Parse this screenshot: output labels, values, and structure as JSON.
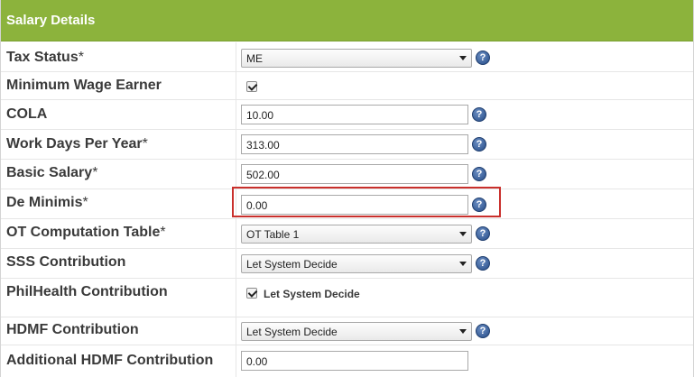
{
  "panel": {
    "title": "Salary Details"
  },
  "fields": {
    "tax_status": {
      "label": "Tax Status",
      "req": "*",
      "value": "ME"
    },
    "min_wage": {
      "label": "Minimum Wage Earner",
      "checked": true
    },
    "cola": {
      "label": "COLA",
      "value": "10.00"
    },
    "work_days": {
      "label": "Work Days Per Year",
      "req": "*",
      "value": "313.00"
    },
    "basic_salary": {
      "label": "Basic Salary",
      "req": "*",
      "value": "502.00"
    },
    "de_minimis": {
      "label": "De Minimis",
      "req": "*",
      "value": "0.00"
    },
    "ot_table": {
      "label": "OT Computation Table",
      "req": "*",
      "value": "OT Table 1"
    },
    "sss": {
      "label": "SSS Contribution",
      "value": "Let System Decide"
    },
    "philhealth": {
      "label": "PhilHealth Contribution",
      "checkbox_label": "Let System Decide",
      "checked": true
    },
    "hdmf": {
      "label": "HDMF Contribution",
      "value": "Let System Decide"
    },
    "additional_hdmf": {
      "label": "Additional HDMF Contribution",
      "value": "0.00"
    }
  },
  "help_icon": {
    "glyph": "?"
  },
  "colors": {
    "header": "#8cb33c",
    "highlight": "#c9302c",
    "help": "#254b86"
  }
}
